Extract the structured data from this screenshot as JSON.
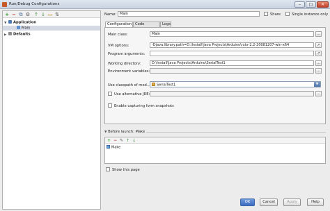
{
  "window": {
    "title": "Run/Debug Configurations",
    "minimize": "–",
    "maximize": "□",
    "close": "✕"
  },
  "toolbar": {
    "add": "+",
    "remove": "−",
    "copy": "⧉",
    "settings": "⚙",
    "move_up": "↑",
    "move_down": "↓",
    "folder": "▭",
    "sort": "⇅"
  },
  "tree": {
    "application": "Application",
    "main": "Main",
    "defaults": "Defaults"
  },
  "header": {
    "name_label": "Name:",
    "name_value": "Main",
    "share_label": "Share",
    "single_instance_label": "Single instance only"
  },
  "tabs": [
    "Configuration",
    "Code Coverage",
    "Logs"
  ],
  "form": {
    "main_class_label": "Main class:",
    "main_class_value": "Main",
    "vm_options_label": "VM options:",
    "vm_options_value": "-Djava.library.path=D:\\Install\\Java Projects\\Arduino\\rxtx-2.2-20081207-win-x64",
    "program_args_label": "Program arguments:",
    "program_args_value": "",
    "working_dir_label": "Working directory:",
    "working_dir_value": "D:\\Install\\Java Projects\\Arduino\\SerialTest1",
    "env_vars_label": "Environment variables:",
    "env_vars_value": "",
    "classpath_label": "Use classpath of mod...",
    "classpath_value": "SerialTest1",
    "alt_jre_label": "Use alternative JRE:",
    "alt_jre_value": "",
    "capture_label": "Enable capturing form snapshots",
    "browse": "...",
    "expand": "↗"
  },
  "before_launch": {
    "title": "Before launch: Make",
    "item": "Make",
    "show_page_label": "Show this page"
  },
  "buttons": {
    "ok": "OK",
    "cancel": "Cancel",
    "apply": "Apply",
    "help": "Help"
  }
}
